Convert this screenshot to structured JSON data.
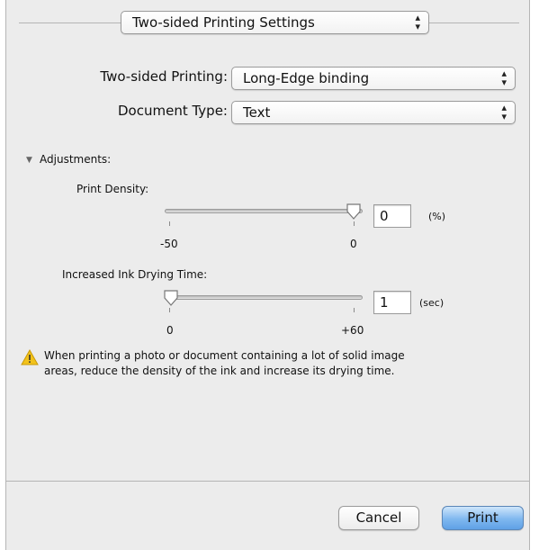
{
  "preset_menu": {
    "label": "Two-sided Printing Settings",
    "arrows": "▴\n▾"
  },
  "two_sided": {
    "label": "Two-sided Printing:",
    "value": "Long-Edge binding"
  },
  "doc_type": {
    "label": "Document Type:",
    "value": "Text"
  },
  "adjustments": {
    "label": "Adjustments:",
    "expanded": true,
    "density": {
      "label": "Print Density:",
      "value": "0",
      "unit": "(%)",
      "min_label": "-50",
      "max_label": "0",
      "min": -50,
      "max": 0,
      "current": 0
    },
    "drying": {
      "label": "Increased Ink Drying Time:",
      "value": "1",
      "unit": "(sec)",
      "min_label": "0",
      "max_label": "+60",
      "min": 0,
      "max": 60,
      "current": 1
    }
  },
  "warning": {
    "line1": "When printing a photo or document containing a lot of solid image",
    "line2": "areas, reduce the density of the ink and increase its drying time.",
    "icon": "warning-triangle-icon"
  },
  "buttons": {
    "cancel": "Cancel",
    "print": "Print"
  },
  "colors": {
    "accent": "#6aa7e8",
    "warning": "#f2c21b"
  }
}
